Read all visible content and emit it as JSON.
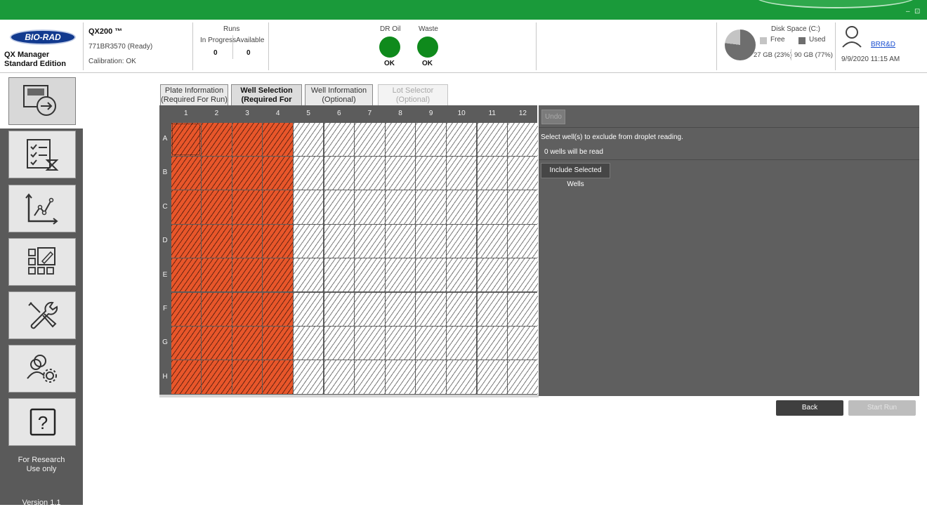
{
  "window": {
    "controls": [
      "–",
      "⊡"
    ]
  },
  "header": {
    "logo_text": "BIO-RAD",
    "app_name_line1": "QX Manager",
    "app_name_line2": "Standard Edition",
    "instrument": {
      "name": "QX200 ™",
      "serial": "771BR3570 (Ready)",
      "calibration": "Calibration: OK"
    },
    "runs": {
      "title": "Runs",
      "in_progress_label": "In Progress",
      "available_label": "Available",
      "in_progress": "0",
      "available": "0"
    },
    "dr_oil": {
      "label": "DR Oil",
      "status": "OK",
      "color": "#0f8a1c"
    },
    "waste": {
      "label": "Waste",
      "status": "OK",
      "color": "#0f8a1c"
    },
    "disk": {
      "title": "Disk Space (C:)",
      "free_label": "Free",
      "used_label": "Used",
      "free_value": "27 GB (23%)",
      "used_value": "90 GB (77%)",
      "used_fraction": 0.77
    },
    "user": {
      "name": "BRR&D",
      "datetime": "9/9/2020 11:15 AM"
    }
  },
  "sidebar": {
    "items": [
      {
        "id": "new-run",
        "icon": "plate-arrow-icon",
        "active": true
      },
      {
        "id": "run-status",
        "icon": "checklist-hourglass-icon"
      },
      {
        "id": "data-analysis",
        "icon": "chart-icon"
      },
      {
        "id": "templates",
        "icon": "grid-edit-icon"
      },
      {
        "id": "tools",
        "icon": "tools-icon"
      },
      {
        "id": "user-admin",
        "icon": "users-gear-icon"
      },
      {
        "id": "help",
        "icon": "help-icon"
      }
    ],
    "ruo_line1": "For Research",
    "ruo_line2": "Use only",
    "version": "Version 1.1"
  },
  "tabs": [
    {
      "line1": "Plate Information",
      "line2": "(Required For Run)",
      "state": "normal"
    },
    {
      "line1": "Well Selection",
      "line2": "(Required For Run)",
      "state": "active"
    },
    {
      "line1": "Well Information",
      "line2": "(Optional)",
      "state": "normal"
    },
    {
      "line1": "Lot Selector",
      "line2": "(Optional)",
      "state": "disabled"
    }
  ],
  "plate": {
    "columns": [
      "1",
      "2",
      "3",
      "4",
      "5",
      "6",
      "7",
      "8",
      "9",
      "10",
      "11",
      "12"
    ],
    "rows": [
      "A",
      "B",
      "C",
      "D",
      "E",
      "F",
      "G",
      "H"
    ],
    "selected_columns": [
      "1",
      "2",
      "3",
      "4"
    ],
    "focused_well": "A1",
    "selected_color": "#e8562a"
  },
  "panel": {
    "undo_label": "Undo",
    "instruction": "Select well(s) to exclude from droplet reading.",
    "count_text": "0 wells will be read",
    "include_button": "Include Selected Wells"
  },
  "footer": {
    "back_label": "Back",
    "start_label": "Start Run"
  }
}
